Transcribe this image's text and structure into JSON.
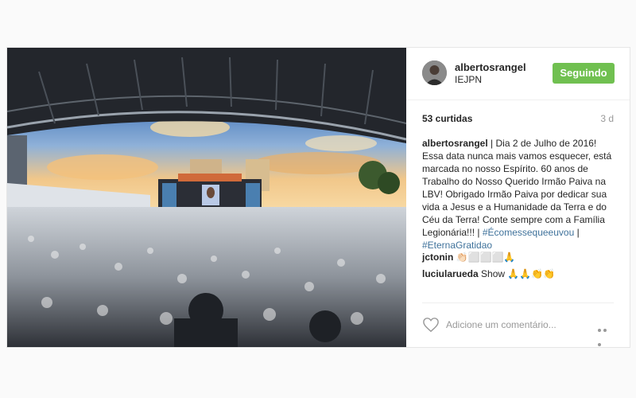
{
  "post": {
    "username": "albertosrangel",
    "location": "IEJPN",
    "follow_label": "Seguindo",
    "likes": "53 curtidas",
    "time": "3 d",
    "caption": {
      "username": "albertosrangel",
      "separator": " | ",
      "text": "Dia 2 de Julho de 2016! Essa data nunca mais vamos esquecer, está marcada no nosso Espírito. 60 anos de Trabalho do Nosso Querido Irmão Paiva na LBV! Obrigado Irmão Paiva por dedicar sua vida a Jesus e a Humanidade da Terra e do Céu da Terra! Conte sempre com a Família Legionária!!! | ",
      "hashtag1": "#Écomessequeeuvou",
      "mid": " | ",
      "hashtag2": "#EternaGratidao"
    },
    "comments": [
      {
        "username": "jctonin",
        "text": " 👏🏻⬜⬜⬜🙏"
      },
      {
        "username": "luciularueda",
        "text": " Show 🙏🙏👏👏"
      }
    ],
    "comment_placeholder": "Adicione um comentário...",
    "colors": {
      "follow_bg": "#70c050",
      "hashtag": "#3f729b"
    },
    "icons": {
      "like": "heart-icon",
      "more": "more-options-icon"
    }
  }
}
